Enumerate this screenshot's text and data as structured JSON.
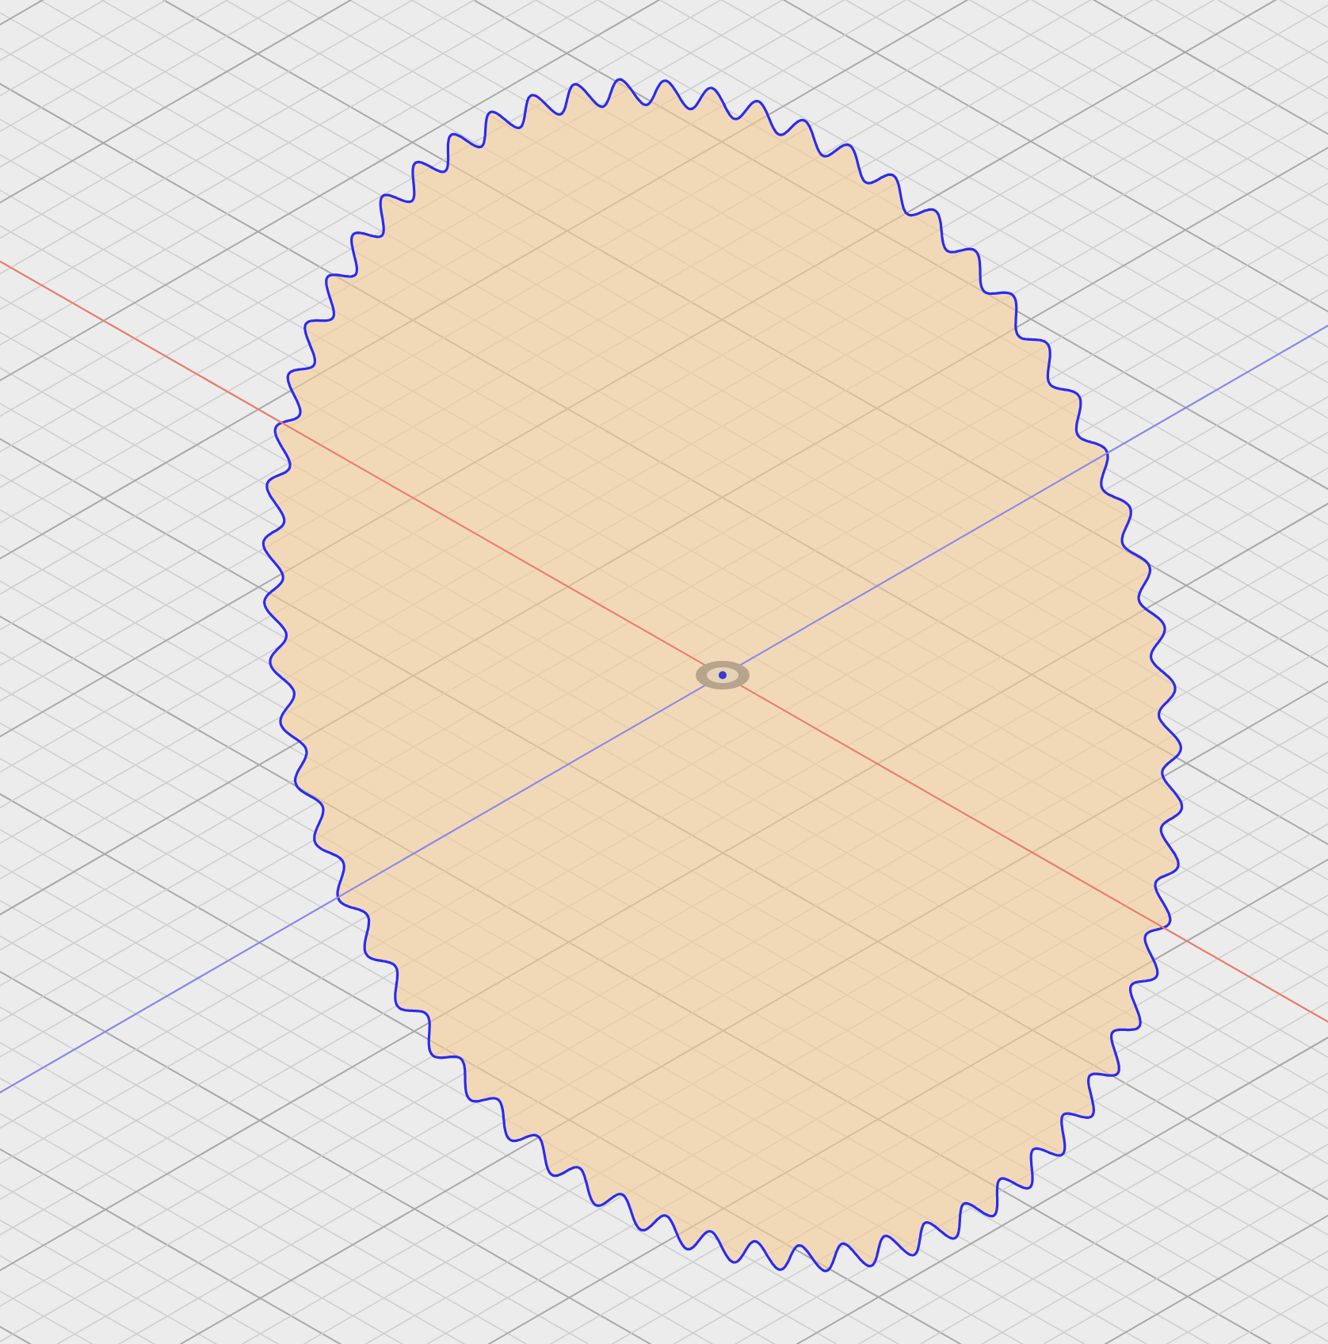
{
  "viewport": {
    "kind": "sketch"
  }
}
